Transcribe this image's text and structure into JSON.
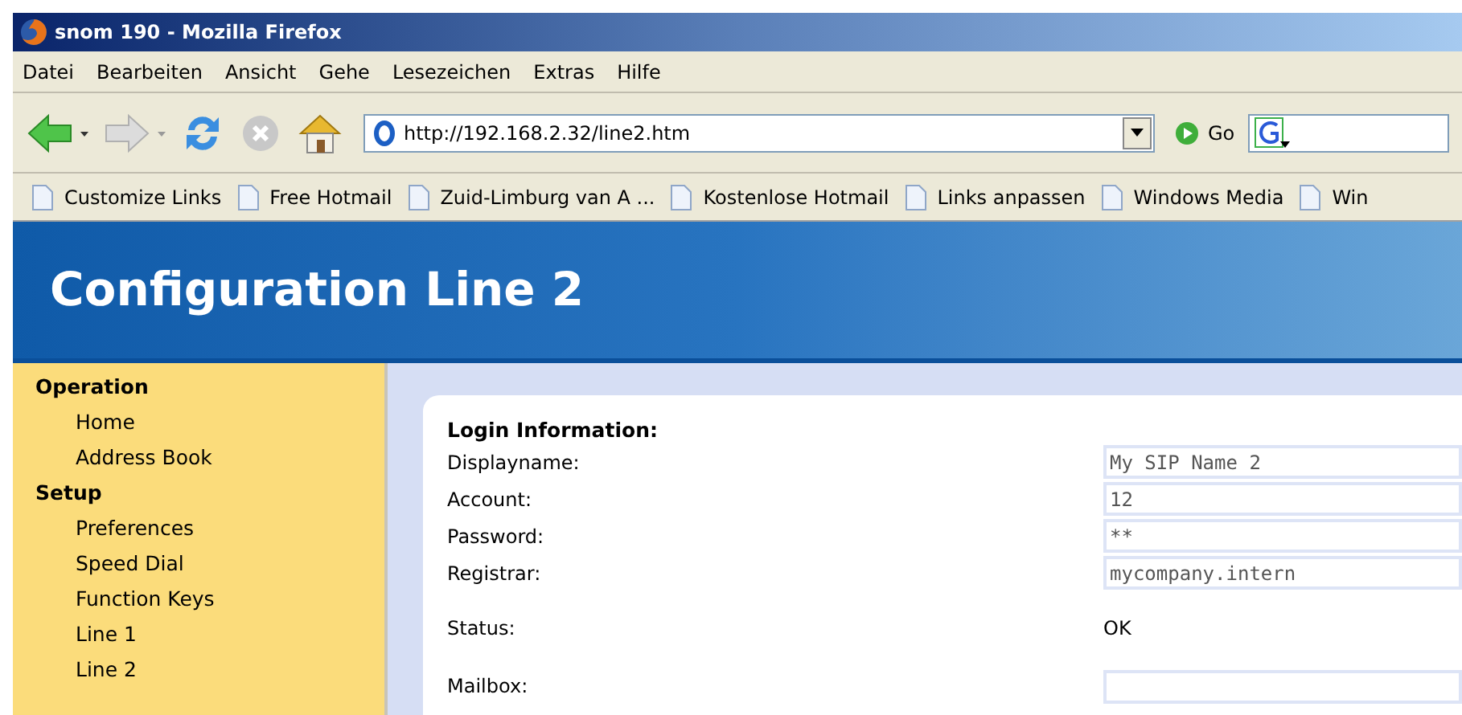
{
  "window": {
    "title": "snom 190 - Mozilla Firefox"
  },
  "menu": [
    "Datei",
    "Bearbeiten",
    "Ansicht",
    "Gehe",
    "Lesezeichen",
    "Extras",
    "Hilfe"
  ],
  "toolbar": {
    "back_disabled": false,
    "forward_disabled": true,
    "stop_disabled": true,
    "url": "http://192.168.2.32/line2.htm",
    "go": "Go"
  },
  "bookmarks": [
    "Customize Links",
    "Free Hotmail",
    "Zuid-Limburg van A ...",
    "Kostenlose Hotmail",
    "Links anpassen",
    "Windows Media",
    "Win"
  ],
  "page": {
    "title": "Configuration Line 2",
    "sidebar": [
      {
        "title": "Operation",
        "items": [
          "Home",
          "Address Book"
        ]
      },
      {
        "title": "Setup",
        "items": [
          "Preferences",
          "Speed Dial",
          "Function Keys",
          "Line 1",
          "Line 2"
        ]
      }
    ],
    "section": "Login Information:",
    "fields": [
      {
        "kind": "input",
        "label": "Displayname:",
        "value": "My SIP Name 2"
      },
      {
        "kind": "input",
        "label": "Account:",
        "value": "12"
      },
      {
        "kind": "input",
        "label": "Password:",
        "value": "**"
      },
      {
        "kind": "input",
        "label": "Registrar:",
        "value": "mycompany.intern"
      },
      {
        "kind": "text",
        "label": "Status:",
        "value": "OK"
      },
      {
        "kind": "input",
        "label": "Mailbox:"
      }
    ]
  }
}
